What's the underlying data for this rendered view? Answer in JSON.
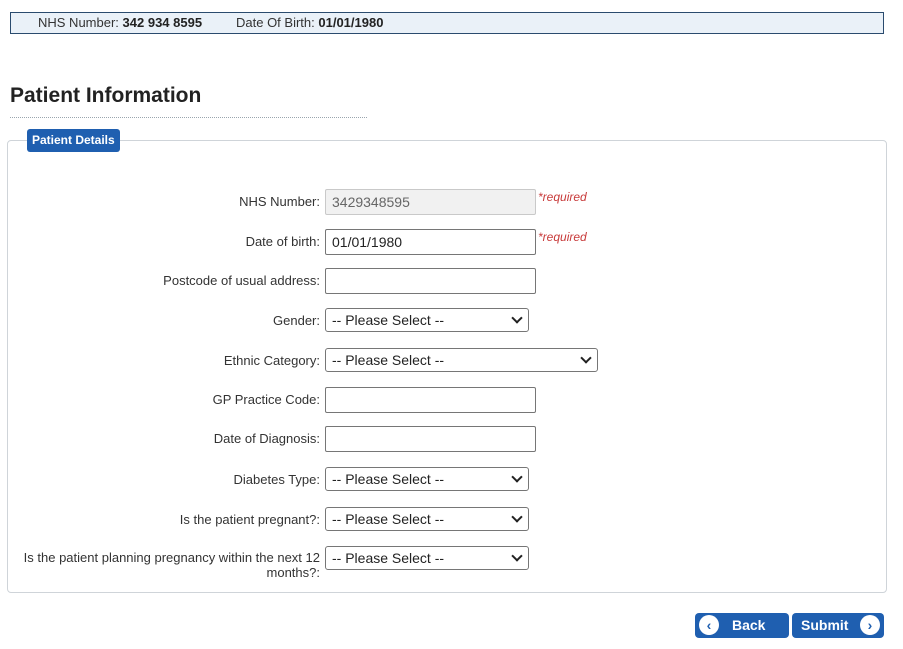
{
  "banner": {
    "nhs_label": "NHS Number:",
    "nhs_value": "342 934 8595",
    "dob_label": "Date Of Birth:",
    "dob_value": "01/01/1980"
  },
  "page": {
    "title": "Patient Information"
  },
  "section": {
    "legend": "Patient Details"
  },
  "fields": {
    "nhs_number": {
      "label": "NHS Number:",
      "value": "3429348595",
      "required": "*required"
    },
    "dob": {
      "label": "Date of birth:",
      "value": "01/01/1980",
      "required": "*required"
    },
    "postcode": {
      "label": "Postcode of usual address:",
      "value": ""
    },
    "gender": {
      "label": "Gender:",
      "value": "-- Please Select --"
    },
    "ethnic": {
      "label": "Ethnic Category:",
      "value": "-- Please Select --"
    },
    "gp_code": {
      "label": "GP Practice Code:",
      "value": ""
    },
    "diagnosis_date": {
      "label": "Date of Diagnosis:",
      "value": ""
    },
    "diabetes_type": {
      "label": "Diabetes Type:",
      "value": "-- Please Select --"
    },
    "pregnant": {
      "label": "Is the patient pregnant?:",
      "value": "-- Please Select --"
    },
    "planning_line1": "Is the patient planning pregnancy within the next 12",
    "planning_line2": "months?:",
    "planning_value": "-- Please Select --"
  },
  "buttons": {
    "back": "Back",
    "submit": "Submit"
  },
  "icons": {
    "back": "arrow-left-circle-icon",
    "submit": "arrow-right-circle-icon"
  },
  "colors": {
    "primary": "#1f5fb0",
    "required": "#c83a3a"
  }
}
